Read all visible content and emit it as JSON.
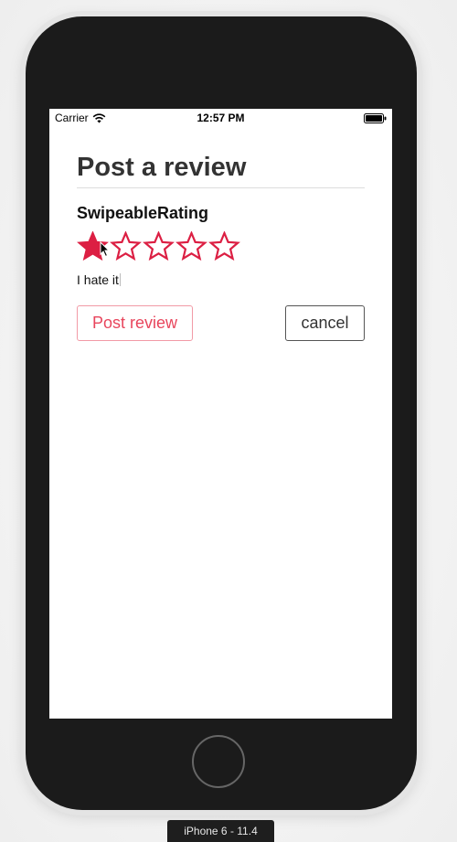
{
  "simulator": {
    "device_label": "iPhone 6 - 11.4"
  },
  "statusbar": {
    "carrier": "Carrier",
    "time": "12:57 PM",
    "icons": [
      "wifi-icon",
      "battery-icon"
    ]
  },
  "review": {
    "title": "Post a review",
    "component_name": "SwipeableRating",
    "rating": 1,
    "max_rating": 5,
    "rating_label": "I hate it",
    "star_color": "#dc1f43",
    "post_label": "Post review",
    "cancel_label": "cancel"
  },
  "colors": {
    "accent": "#e8455c",
    "title": "#333333"
  }
}
